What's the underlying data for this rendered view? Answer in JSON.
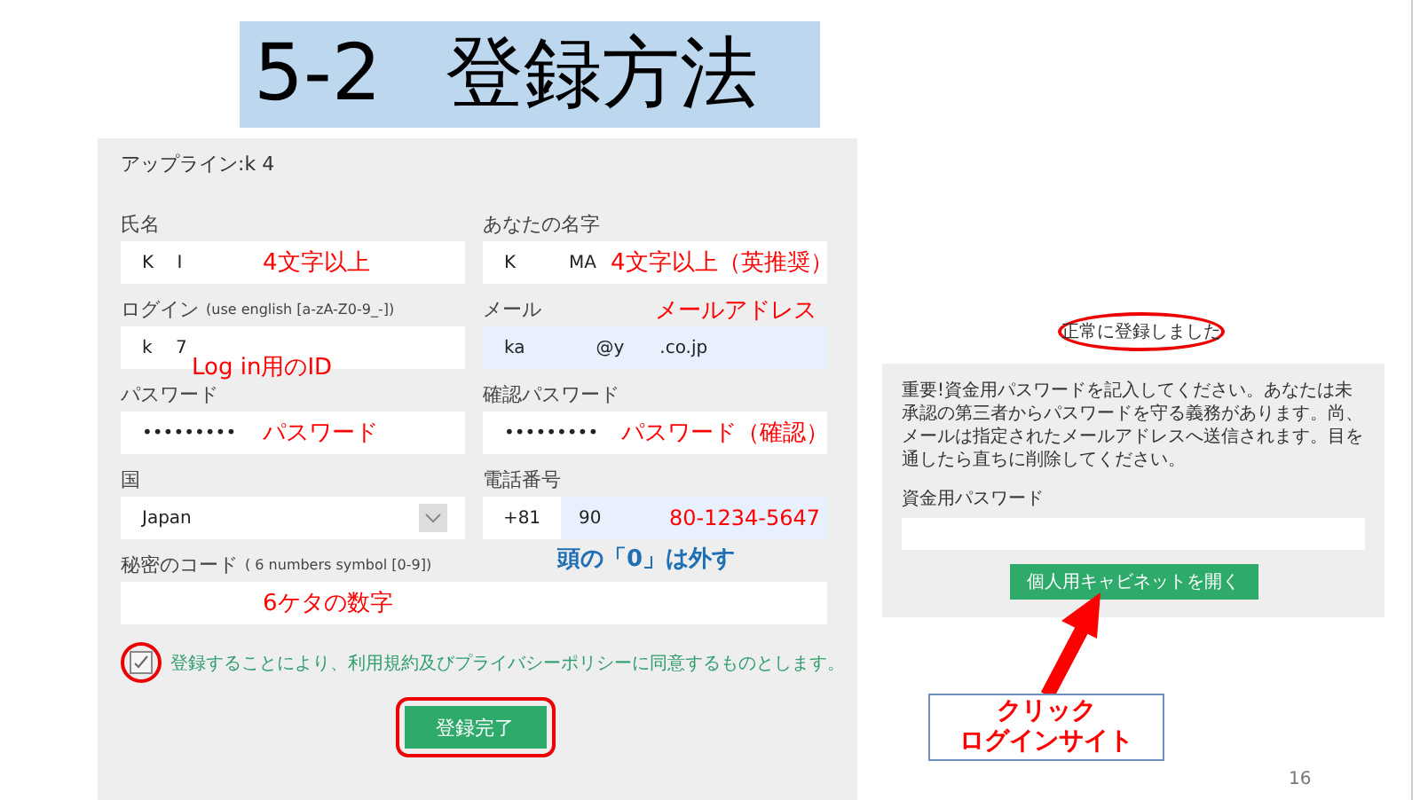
{
  "slide": {
    "title": "5-2 登録方法",
    "page_number": "16"
  },
  "registration_form": {
    "upline": "アップライン:k 4",
    "fields": [
      {
        "kind": "text",
        "label": "氏名",
        "value": "K　 I",
        "annotation": "4文字以上",
        "autofilled": false
      },
      {
        "kind": "text",
        "label": "あなたの名字",
        "value": "K　　　MA",
        "annotation": "4文字以上（英推奨）",
        "autofilled": false
      },
      {
        "kind": "text",
        "label": "ログイン",
        "hint": "(use english [a-zA-Z0-9_-])",
        "value": "k　 7",
        "annotation": "Log in用のID",
        "autofilled": false
      },
      {
        "kind": "text",
        "label": "メール",
        "value": "ka　　　　@y　　.co.jp",
        "annotation": "メールアドレス",
        "autofilled": true
      },
      {
        "kind": "password",
        "label": "パスワード",
        "value": "•••••••••",
        "annotation": "パスワード",
        "autofilled": false
      },
      {
        "kind": "password",
        "label": "確認パスワード",
        "value": "•••••••••",
        "annotation": "パスワード（確認）",
        "autofilled": false
      },
      {
        "kind": "select",
        "label": "国",
        "value": "Japan",
        "autofilled": false
      },
      {
        "kind": "phone",
        "label": "電話番号",
        "prefix": "+81",
        "value": "90",
        "annotation": "80-1234-5647",
        "note": "頭の「0」は外す",
        "autofilled": true
      },
      {
        "kind": "wide",
        "label": "秘密のコード",
        "hint": "( 6 numbers symbol [0-9])",
        "annotation": "6ケタの数字",
        "autofilled": false
      }
    ],
    "agreement": {
      "checked": true,
      "text": "登録することにより、利用規約及びプライバシーポリシーに同意するものとします。"
    },
    "submit": "登録完了"
  },
  "success_panel": {
    "message": "正常に登録しました",
    "notice": "重要!資金用パスワードを記入してください。あなたは未承認の第三者からパスワードを守る義務があります。尚、メールは指定されたメールアドレスへ送信されます。目を通したら直ちに削除してください。",
    "field_label": "資金用パスワード",
    "button": "個人用キャビネットを開く"
  },
  "callout": {
    "lines": [
      "クリック",
      "ログインサイト"
    ]
  }
}
